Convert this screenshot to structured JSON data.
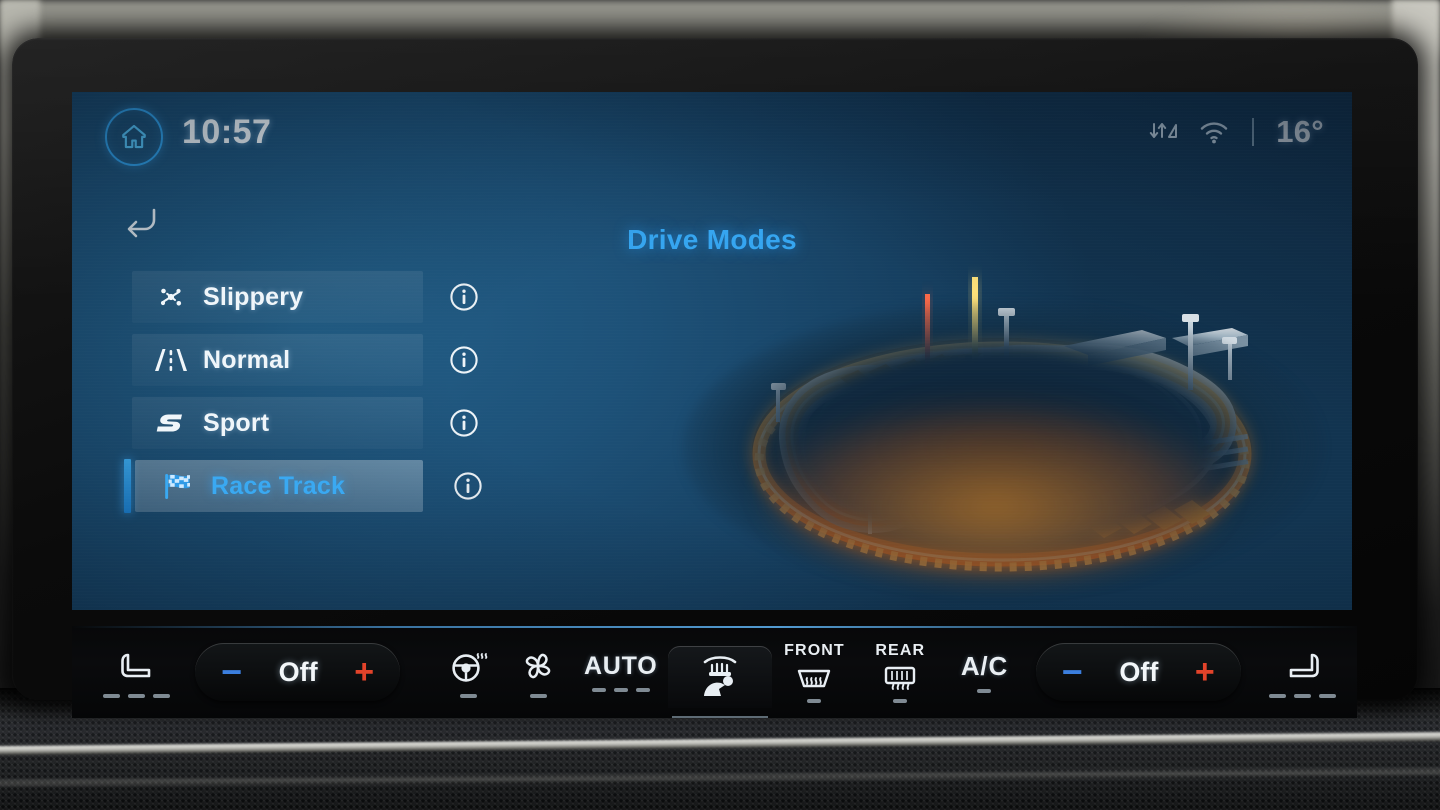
{
  "status_bar": {
    "home_icon": "home-icon",
    "clock": "10:57",
    "data_icon": "data-transfer-signal-icon",
    "wifi_icon": "wifi-icon",
    "separator": "|",
    "outside_temp": "16°"
  },
  "navigation": {
    "back_icon": "back-arrow-icon"
  },
  "screen": {
    "title": "Drive Modes"
  },
  "drive_modes": {
    "selected": "Race Track",
    "info_icon": "info-icon",
    "items": [
      {
        "label": "Slippery",
        "icon": "snowflake-icon",
        "selected": false
      },
      {
        "label": "Normal",
        "icon": "road-lane-icon",
        "selected": false
      },
      {
        "label": "Sport",
        "icon": "sport-s-icon",
        "selected": false
      },
      {
        "label": "Race Track",
        "icon": "checkered-flag-icon",
        "selected": true
      }
    ]
  },
  "illustration": {
    "name": "race-track-3d-graphic",
    "description": "Glowing 3D race circuit on dark oval base"
  },
  "climate_bar": {
    "driver_seat_heat": {
      "icon": "heated-seat-left-icon",
      "levels": 3
    },
    "driver_temp": {
      "minus": "−",
      "value": "Off",
      "plus": "+"
    },
    "steering_wheel_heat": {
      "icon": "heated-steering-wheel-icon",
      "levels": 1
    },
    "fan": {
      "icon": "fan-icon",
      "levels": 1
    },
    "auto": {
      "label": "AUTO",
      "levels": 3
    },
    "airflow": {
      "icon": "airflow-person-icon"
    },
    "front_defrost": {
      "caption": "FRONT",
      "icon": "front-defrost-icon",
      "levels": 1
    },
    "rear_defrost": {
      "caption": "REAR",
      "icon": "rear-defrost-icon",
      "levels": 1
    },
    "ac": {
      "label": "A/C",
      "levels": 1
    },
    "passenger_temp": {
      "minus": "−",
      "value": "Off",
      "plus": "+"
    },
    "passenger_seat_heat": {
      "icon": "heated-seat-right-icon",
      "levels": 3
    }
  },
  "colors": {
    "accent_blue": "#35a5f0",
    "screen_blue": "#1d5178",
    "track_orange": "#ff8c1a",
    "minus_blue": "#3b7ede",
    "plus_red": "#e2432a",
    "text_white": "#f0f6fa"
  }
}
